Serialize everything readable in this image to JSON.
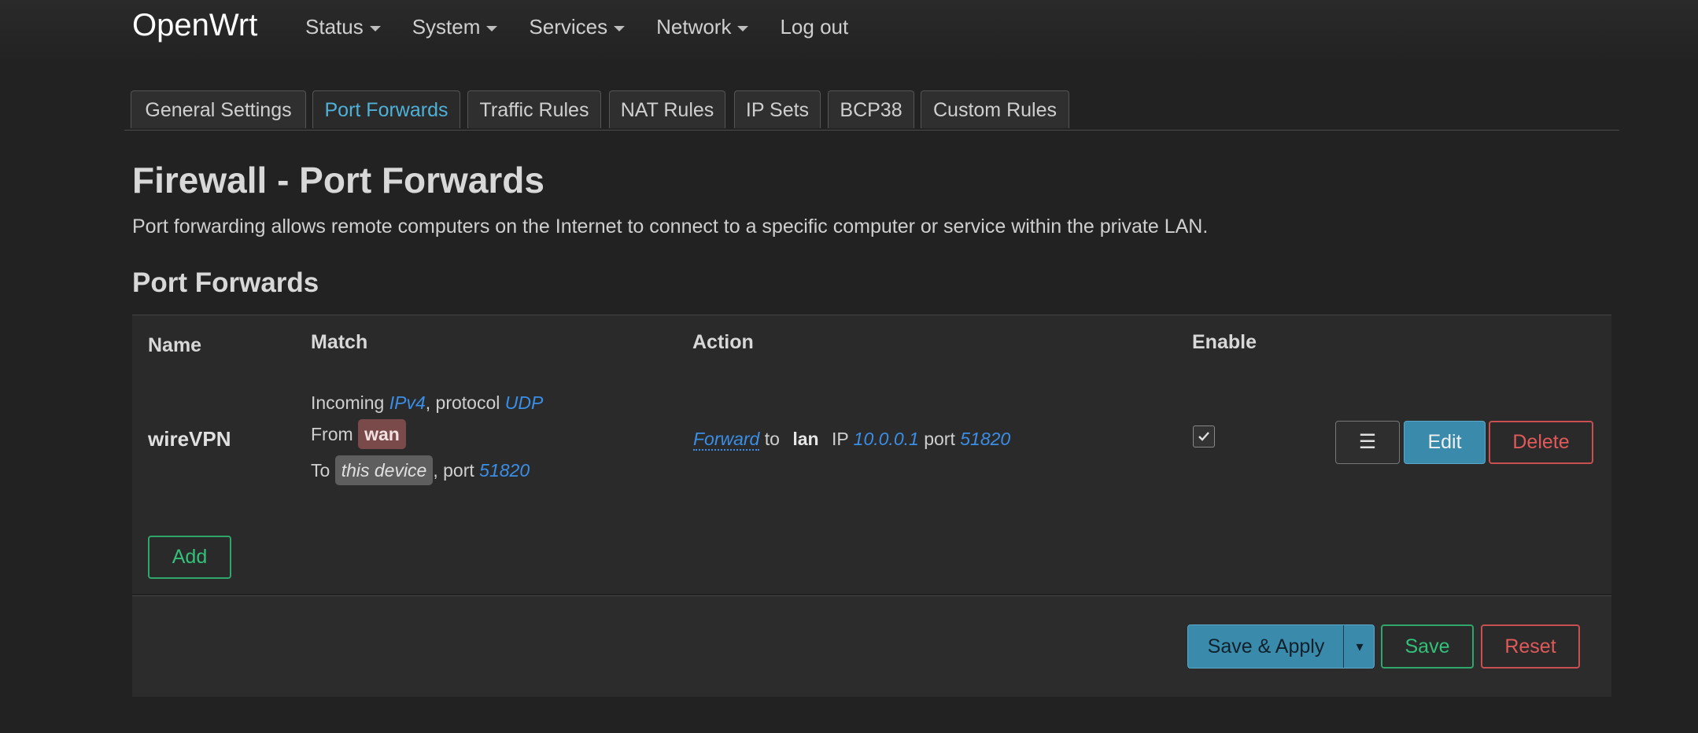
{
  "brand": "OpenWrt",
  "nav": [
    {
      "label": "Status",
      "dropdown": true
    },
    {
      "label": "System",
      "dropdown": true
    },
    {
      "label": "Services",
      "dropdown": true
    },
    {
      "label": "Network",
      "dropdown": true
    },
    {
      "label": "Log out",
      "dropdown": false
    }
  ],
  "tabs": [
    {
      "label": "General Settings"
    },
    {
      "label": "Port Forwards",
      "active": true
    },
    {
      "label": "Traffic Rules"
    },
    {
      "label": "NAT Rules"
    },
    {
      "label": "IP Sets"
    },
    {
      "label": "BCP38"
    },
    {
      "label": "Custom Rules"
    }
  ],
  "page": {
    "title": "Firewall - Port Forwards",
    "description": "Port forwarding allows remote computers on the Internet to connect to a specific computer or service within the private LAN.",
    "section_title": "Port Forwards"
  },
  "table": {
    "headers": {
      "name": "Name",
      "match": "Match",
      "action": "Action",
      "enable": "Enable"
    },
    "rows": [
      {
        "name": "wireVPN",
        "match": {
          "incoming_label": "Incoming",
          "family": "IPv4",
          "protocol_label": ", protocol",
          "protocol": "UDP",
          "from_label": "From",
          "from_zone": "wan",
          "to_label": "To",
          "to_target": "this device",
          "port_label": ", port",
          "port": "51820"
        },
        "action": {
          "verb": "Forward",
          "to_label": "to",
          "zone": "lan",
          "ip_label": "IP",
          "ip": "10.0.0.1",
          "port_label": "port",
          "port": "51820"
        },
        "enabled": true,
        "buttons": {
          "menu": "☰",
          "edit": "Edit",
          "delete": "Delete"
        }
      }
    ],
    "add_label": "Add"
  },
  "footer": {
    "save_apply": "Save & Apply",
    "save_apply_caret": "▾",
    "save": "Save",
    "reset": "Reset"
  },
  "colors": {
    "background": "#222222",
    "accent": "#4fb0d8",
    "link": "#3a8ee6",
    "positive": "#33c17a",
    "negative": "#e05a5a"
  }
}
